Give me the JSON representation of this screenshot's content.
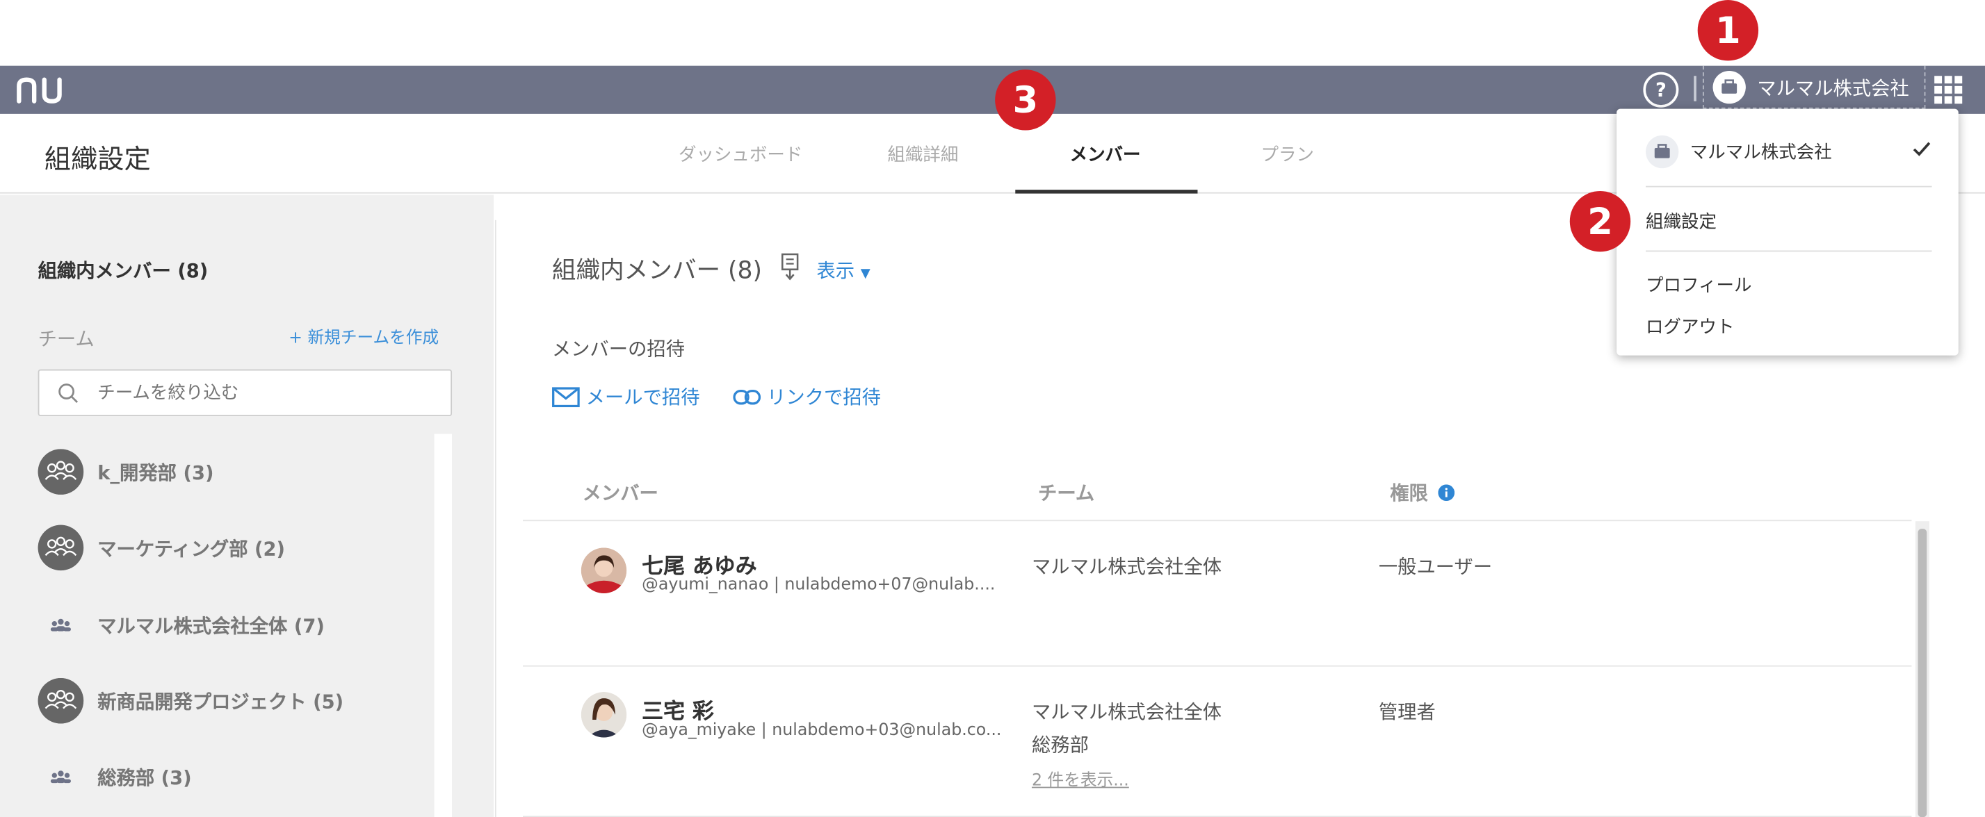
{
  "header": {
    "logo_text": "nu",
    "help_label": "?",
    "org_name": "マルマル株式会社"
  },
  "subheader": {
    "page_title": "組織設定",
    "tabs": [
      {
        "label": "ダッシュボード",
        "active": false
      },
      {
        "label": "組織詳細",
        "active": false
      },
      {
        "label": "メンバー",
        "active": true
      },
      {
        "label": "プラン",
        "active": false
      }
    ]
  },
  "sidebar": {
    "members_header": "組織内メンバー (8)",
    "team_label": "チーム",
    "new_team_label": "+ 新規チームを作成",
    "filter_placeholder": "チームを絞り込む",
    "teams": [
      {
        "name": "k_開発部 (3)",
        "icon": "group-avatar-icon"
      },
      {
        "name": "マーケティング部 (2)",
        "icon": "group-avatar-icon"
      },
      {
        "name": "マルマル株式会社全体 (7)",
        "icon": "small-group-icon"
      },
      {
        "name": "新商品開発プロジェクト (5)",
        "icon": "group-avatar-icon"
      },
      {
        "name": "総務部 (3)",
        "icon": "small-group-icon"
      }
    ]
  },
  "main": {
    "title": "組織内メンバー (8)",
    "show_label": "表示",
    "invite_label": "メンバーの招待",
    "mail_invite_label": "メールで招待",
    "link_invite_label": "リンクで招待",
    "columns": {
      "member": "メンバー",
      "team": "チーム",
      "role": "権限"
    },
    "members": [
      {
        "name": "七尾 あゆみ",
        "meta": "@ayumi_nanao | nulabdemo+07@nulab....",
        "teams": [
          "マルマル株式会社全体"
        ],
        "more": "",
        "role": "一般ユーザー"
      },
      {
        "name": "三宅 彩",
        "meta": "@aya_miyake | nulabdemo+03@nulab.co...",
        "teams": [
          "マルマル株式会社全体",
          "総務部"
        ],
        "more": "2 件を表示...",
        "role": "管理者"
      }
    ]
  },
  "dropdown": {
    "org_name": "マルマル株式会社",
    "org_settings": "組織設定",
    "profile": "プロフィール",
    "logout": "ログアウト"
  },
  "annotations": [
    "1",
    "2",
    "3"
  ],
  "colors": {
    "topbar": "#6e7388",
    "accent_link": "#2f86d4",
    "badge_red": "#d32027"
  }
}
